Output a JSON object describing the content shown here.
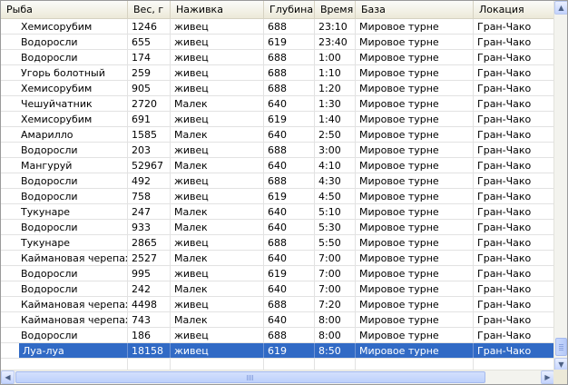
{
  "columns": [
    "Рыба",
    "Вес, г",
    "Наживка",
    "Глубина",
    "Время",
    "База",
    "Локация"
  ],
  "rows": [
    [
      "Хемисорубим",
      "1246",
      "живец",
      "688",
      "23:10",
      "Мировое турне",
      "Гран-Чако"
    ],
    [
      "Водоросли",
      "655",
      "живец",
      "619",
      "23:40",
      "Мировое турне",
      "Гран-Чако"
    ],
    [
      "Водоросли",
      "174",
      "живец",
      "688",
      "1:00",
      "Мировое турне",
      "Гран-Чако"
    ],
    [
      "Угорь болотный",
      "259",
      "живец",
      "688",
      "1:10",
      "Мировое турне",
      "Гран-Чако"
    ],
    [
      "Хемисорубим",
      "905",
      "живец",
      "688",
      "1:20",
      "Мировое турне",
      "Гран-Чако"
    ],
    [
      "Чешуйчатник",
      "2720",
      "Малек",
      "640",
      "1:30",
      "Мировое турне",
      "Гран-Чако"
    ],
    [
      "Хемисорубим",
      "691",
      "живец",
      "619",
      "1:40",
      "Мировое турне",
      "Гран-Чако"
    ],
    [
      "Амарилло",
      "1585",
      "Малек",
      "640",
      "2:50",
      "Мировое турне",
      "Гран-Чако"
    ],
    [
      "Водоросли",
      "203",
      "живец",
      "688",
      "3:00",
      "Мировое турне",
      "Гран-Чако"
    ],
    [
      "Мангуруй",
      "52967",
      "Малек",
      "640",
      "4:10",
      "Мировое турне",
      "Гран-Чако"
    ],
    [
      "Водоросли",
      "492",
      "живец",
      "688",
      "4:30",
      "Мировое турне",
      "Гран-Чако"
    ],
    [
      "Водоросли",
      "758",
      "живец",
      "619",
      "4:50",
      "Мировое турне",
      "Гран-Чако"
    ],
    [
      "Тукунаре",
      "247",
      "Малек",
      "640",
      "5:10",
      "Мировое турне",
      "Гран-Чако"
    ],
    [
      "Водоросли",
      "933",
      "Малек",
      "640",
      "5:30",
      "Мировое турне",
      "Гран-Чако"
    ],
    [
      "Тукунаре",
      "2865",
      "живец",
      "688",
      "5:50",
      "Мировое турне",
      "Гран-Чако"
    ],
    [
      "Каймановая черепаха",
      "2527",
      "Малек",
      "640",
      "7:00",
      "Мировое турне",
      "Гран-Чако"
    ],
    [
      "Водоросли",
      "995",
      "живец",
      "619",
      "7:00",
      "Мировое турне",
      "Гран-Чако"
    ],
    [
      "Водоросли",
      "242",
      "Малек",
      "640",
      "7:00",
      "Мировое турне",
      "Гран-Чако"
    ],
    [
      "Каймановая черепаха",
      "4498",
      "живец",
      "688",
      "7:20",
      "Мировое турне",
      "Гран-Чако"
    ],
    [
      "Каймановая черепаха",
      "743",
      "Малек",
      "640",
      "8:00",
      "Мировое турне",
      "Гран-Чако"
    ],
    [
      "Водоросли",
      "186",
      "живец",
      "688",
      "8:00",
      "Мировое турне",
      "Гран-Чако"
    ],
    [
      "Луа-луа",
      "18158",
      "живец",
      "619",
      "8:50",
      "Мировое турне",
      "Гран-Чако"
    ]
  ],
  "selected_row": 21,
  "scroll": {
    "vertical_position": 0.97,
    "horizontal_position": 0.0
  },
  "icons": {
    "up": "arrow-up-icon",
    "down": "arrow-down-icon",
    "left": "arrow-left-icon",
    "right": "arrow-right-icon"
  },
  "colors": {
    "selection": "#316ac5",
    "header": "#ece9d8"
  }
}
